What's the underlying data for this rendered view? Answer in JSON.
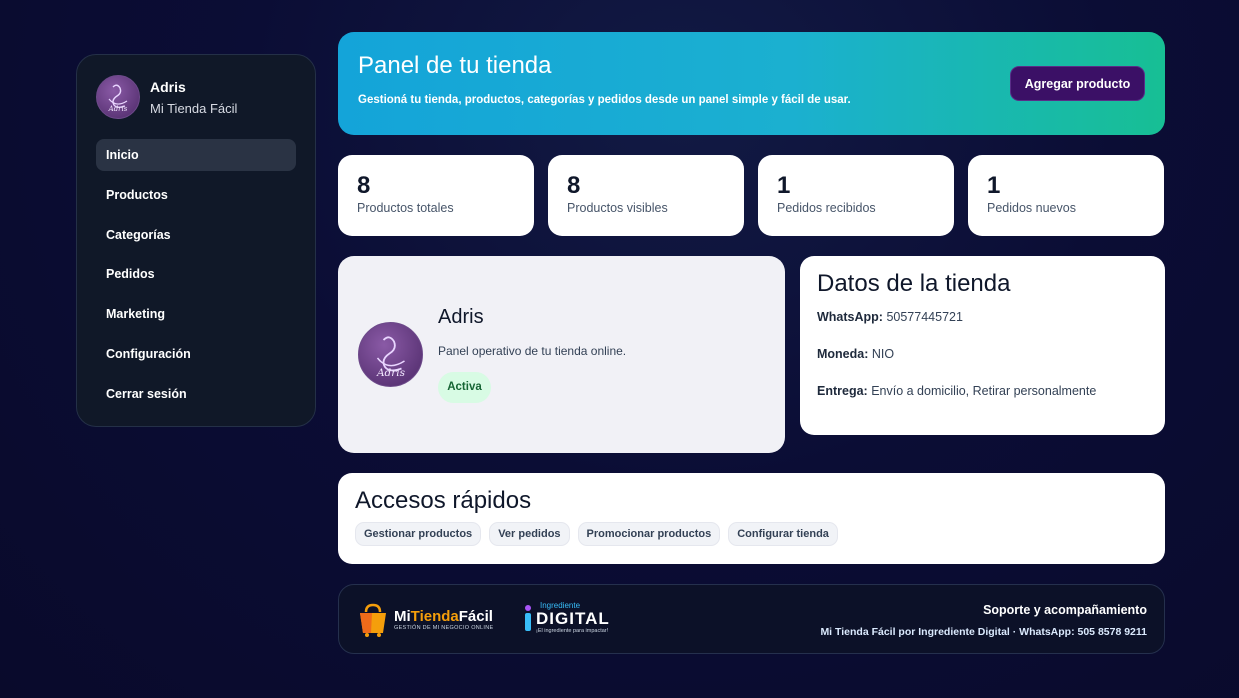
{
  "sidebar": {
    "store_owner": "Adris",
    "store_name": "Mi Tienda Fácil",
    "avatar_text": "Adris",
    "nav": [
      {
        "label": "Inicio",
        "active": true
      },
      {
        "label": "Productos"
      },
      {
        "label": "Categorías"
      },
      {
        "label": "Pedidos"
      },
      {
        "label": "Marketing"
      },
      {
        "label": "Configuración"
      },
      {
        "label": "Cerrar sesión"
      }
    ]
  },
  "hero": {
    "title": "Panel de tu tienda",
    "subtitle": "Gestioná tu tienda, productos, categorías y pedidos desde un panel simple y fácil de usar.",
    "button": "Agregar producto"
  },
  "stats": [
    {
      "value": "8",
      "label": "Productos totales"
    },
    {
      "value": "8",
      "label": "Productos visibles"
    },
    {
      "value": "1",
      "label": "Pedidos recibidos"
    },
    {
      "value": "1",
      "label": "Pedidos nuevos"
    }
  ],
  "profile": {
    "name": "Adris",
    "description": "Panel operativo de tu tienda online.",
    "status": "Activa",
    "avatar_text": "Adris"
  },
  "store_data": {
    "title": "Datos de la tienda",
    "rows": [
      {
        "key": "WhatsApp:",
        "value": "50577445721"
      },
      {
        "key": "Moneda:",
        "value": "NIO"
      },
      {
        "key": "Entrega:",
        "value": "Envío a domicilio, Retirar personalmente"
      }
    ]
  },
  "quick_access": {
    "title": "Accesos rápidos",
    "items": [
      "Gestionar productos",
      "Ver pedidos",
      "Promocionar productos",
      "Configurar tienda"
    ]
  },
  "footer": {
    "logo1_prefix": "Mi",
    "logo1_mid": "Tienda",
    "logo1_suffix": "Fácil",
    "logo1_tagline": "GESTIÓN DE MI NEGOCIO ONLINE",
    "logo2_small": "Ingrediente",
    "logo2_big": "DIGITAL",
    "logo2_tagline": "¡El ingrediente para impactar!",
    "support_title": "Soporte y acompañamiento",
    "support_text": "Mi Tienda Fácil por Ingrediente Digital · WhatsApp: 505 8578 9211"
  },
  "colors": {
    "background": "#0b0d35",
    "sidebar": "#101828",
    "hero_start": "#14a4d9",
    "hero_end": "#17bf94",
    "primary_button": "#3b1066",
    "badge_bg": "#d8fbe4",
    "logo_orange": "#f59e0b"
  }
}
